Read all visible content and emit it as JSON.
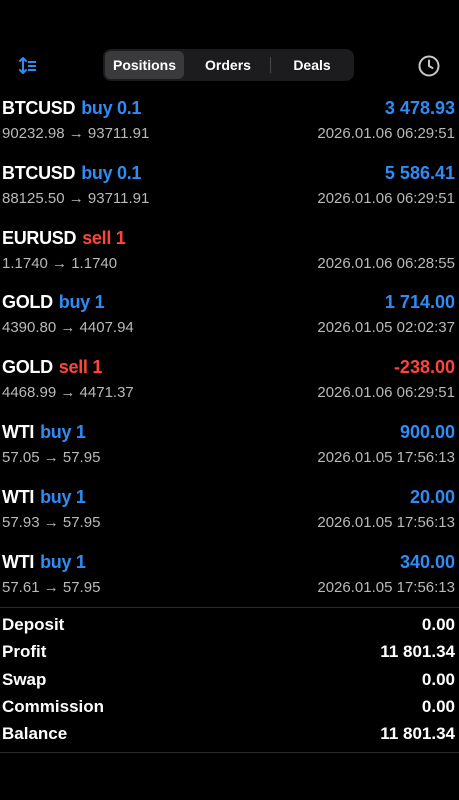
{
  "tabs": [
    "Positions",
    "Orders",
    "Deals"
  ],
  "active_tab": "Positions",
  "icons": {
    "sort": "sort-icon",
    "history": "clock-icon"
  },
  "colors": {
    "buy": "#2f8cf5",
    "sell": "#ff453a",
    "secondary_text": "#b9b9bb"
  },
  "positions": [
    {
      "symbol": "BTCUSD",
      "side": "buy 0.1",
      "type": "buy",
      "profit": "3 478.93",
      "prices": "90232.98 → 93711.91",
      "time": "2026.01.06 06:29:51"
    },
    {
      "symbol": "BTCUSD",
      "side": "buy 0.1",
      "type": "buy",
      "profit": "5 586.41",
      "prices": "88125.50 → 93711.91",
      "time": "2026.01.06 06:29:51"
    },
    {
      "symbol": "EURUSD",
      "side": "sell 1",
      "type": "sell",
      "profit": "",
      "prices": "1.1740 → 1.1740",
      "time": "2026.01.06 06:28:55"
    },
    {
      "symbol": "GOLD",
      "side": "buy 1",
      "type": "buy",
      "profit": "1 714.00",
      "prices": "4390.80 → 4407.94",
      "time": "2026.01.05 02:02:37"
    },
    {
      "symbol": "GOLD",
      "side": "sell 1",
      "type": "sell",
      "profit": "-238.00",
      "prices": "4468.99 → 4471.37",
      "time": "2026.01.06 06:29:51"
    },
    {
      "symbol": "WTI",
      "side": "buy 1",
      "type": "buy",
      "profit": "900.00",
      "prices": "57.05 → 57.95",
      "time": "2026.01.05 17:56:13"
    },
    {
      "symbol": "WTI",
      "side": "buy 1",
      "type": "buy",
      "profit": "20.00",
      "prices": "57.93 → 57.95",
      "time": "2026.01.05 17:56:13"
    },
    {
      "symbol": "WTI",
      "side": "buy 1",
      "type": "buy",
      "profit": "340.00",
      "prices": "57.61 → 57.95",
      "time": "2026.01.05 17:56:13"
    }
  ],
  "summary": [
    {
      "label": "Deposit",
      "value": "0.00"
    },
    {
      "label": "Profit",
      "value": "11 801.34"
    },
    {
      "label": "Swap",
      "value": "0.00"
    },
    {
      "label": "Commission",
      "value": "0.00"
    },
    {
      "label": "Balance",
      "value": "11 801.34"
    }
  ]
}
